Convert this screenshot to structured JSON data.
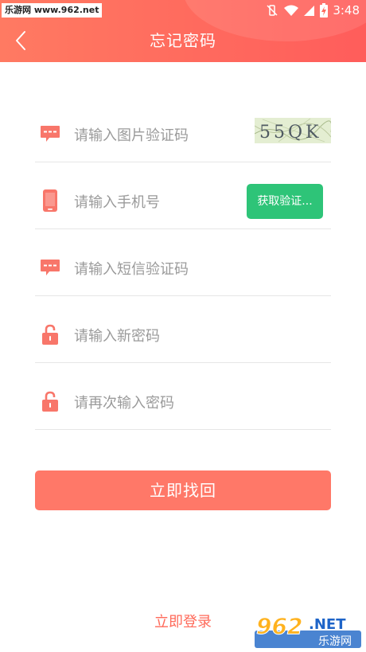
{
  "status_bar": {
    "watermark": "乐游网 www.962.net",
    "time": "3:48"
  },
  "header": {
    "title": "忘记密码"
  },
  "form": {
    "captcha_placeholder": "请输入图片验证码",
    "captcha_image_text": "55QK",
    "phone_placeholder": "请输入手机号",
    "get_code_label": "获取验证...",
    "sms_placeholder": "请输入短信验证码",
    "new_password_placeholder": "请输入新密码",
    "confirm_password_placeholder": "请再次输入密码"
  },
  "actions": {
    "submit_label": "立即找回",
    "login_label": "立即登录"
  },
  "corner_watermark": {
    "number": "962",
    "suffix": ".NET",
    "site_name": "乐游网"
  },
  "colors": {
    "header_start": "#ff7a62",
    "header_end": "#ff5d5b",
    "accent": "#ff7868",
    "icon": "#f8766a",
    "sms_button": "#2ec478",
    "link": "#ff6a5a",
    "placeholder": "#9a9a9a",
    "divider": "#e6e6e6"
  },
  "icons": {
    "back": "chevron-left-icon",
    "captcha": "message-icon",
    "phone": "phone-icon",
    "sms": "message-icon",
    "password": "lock-icon"
  }
}
